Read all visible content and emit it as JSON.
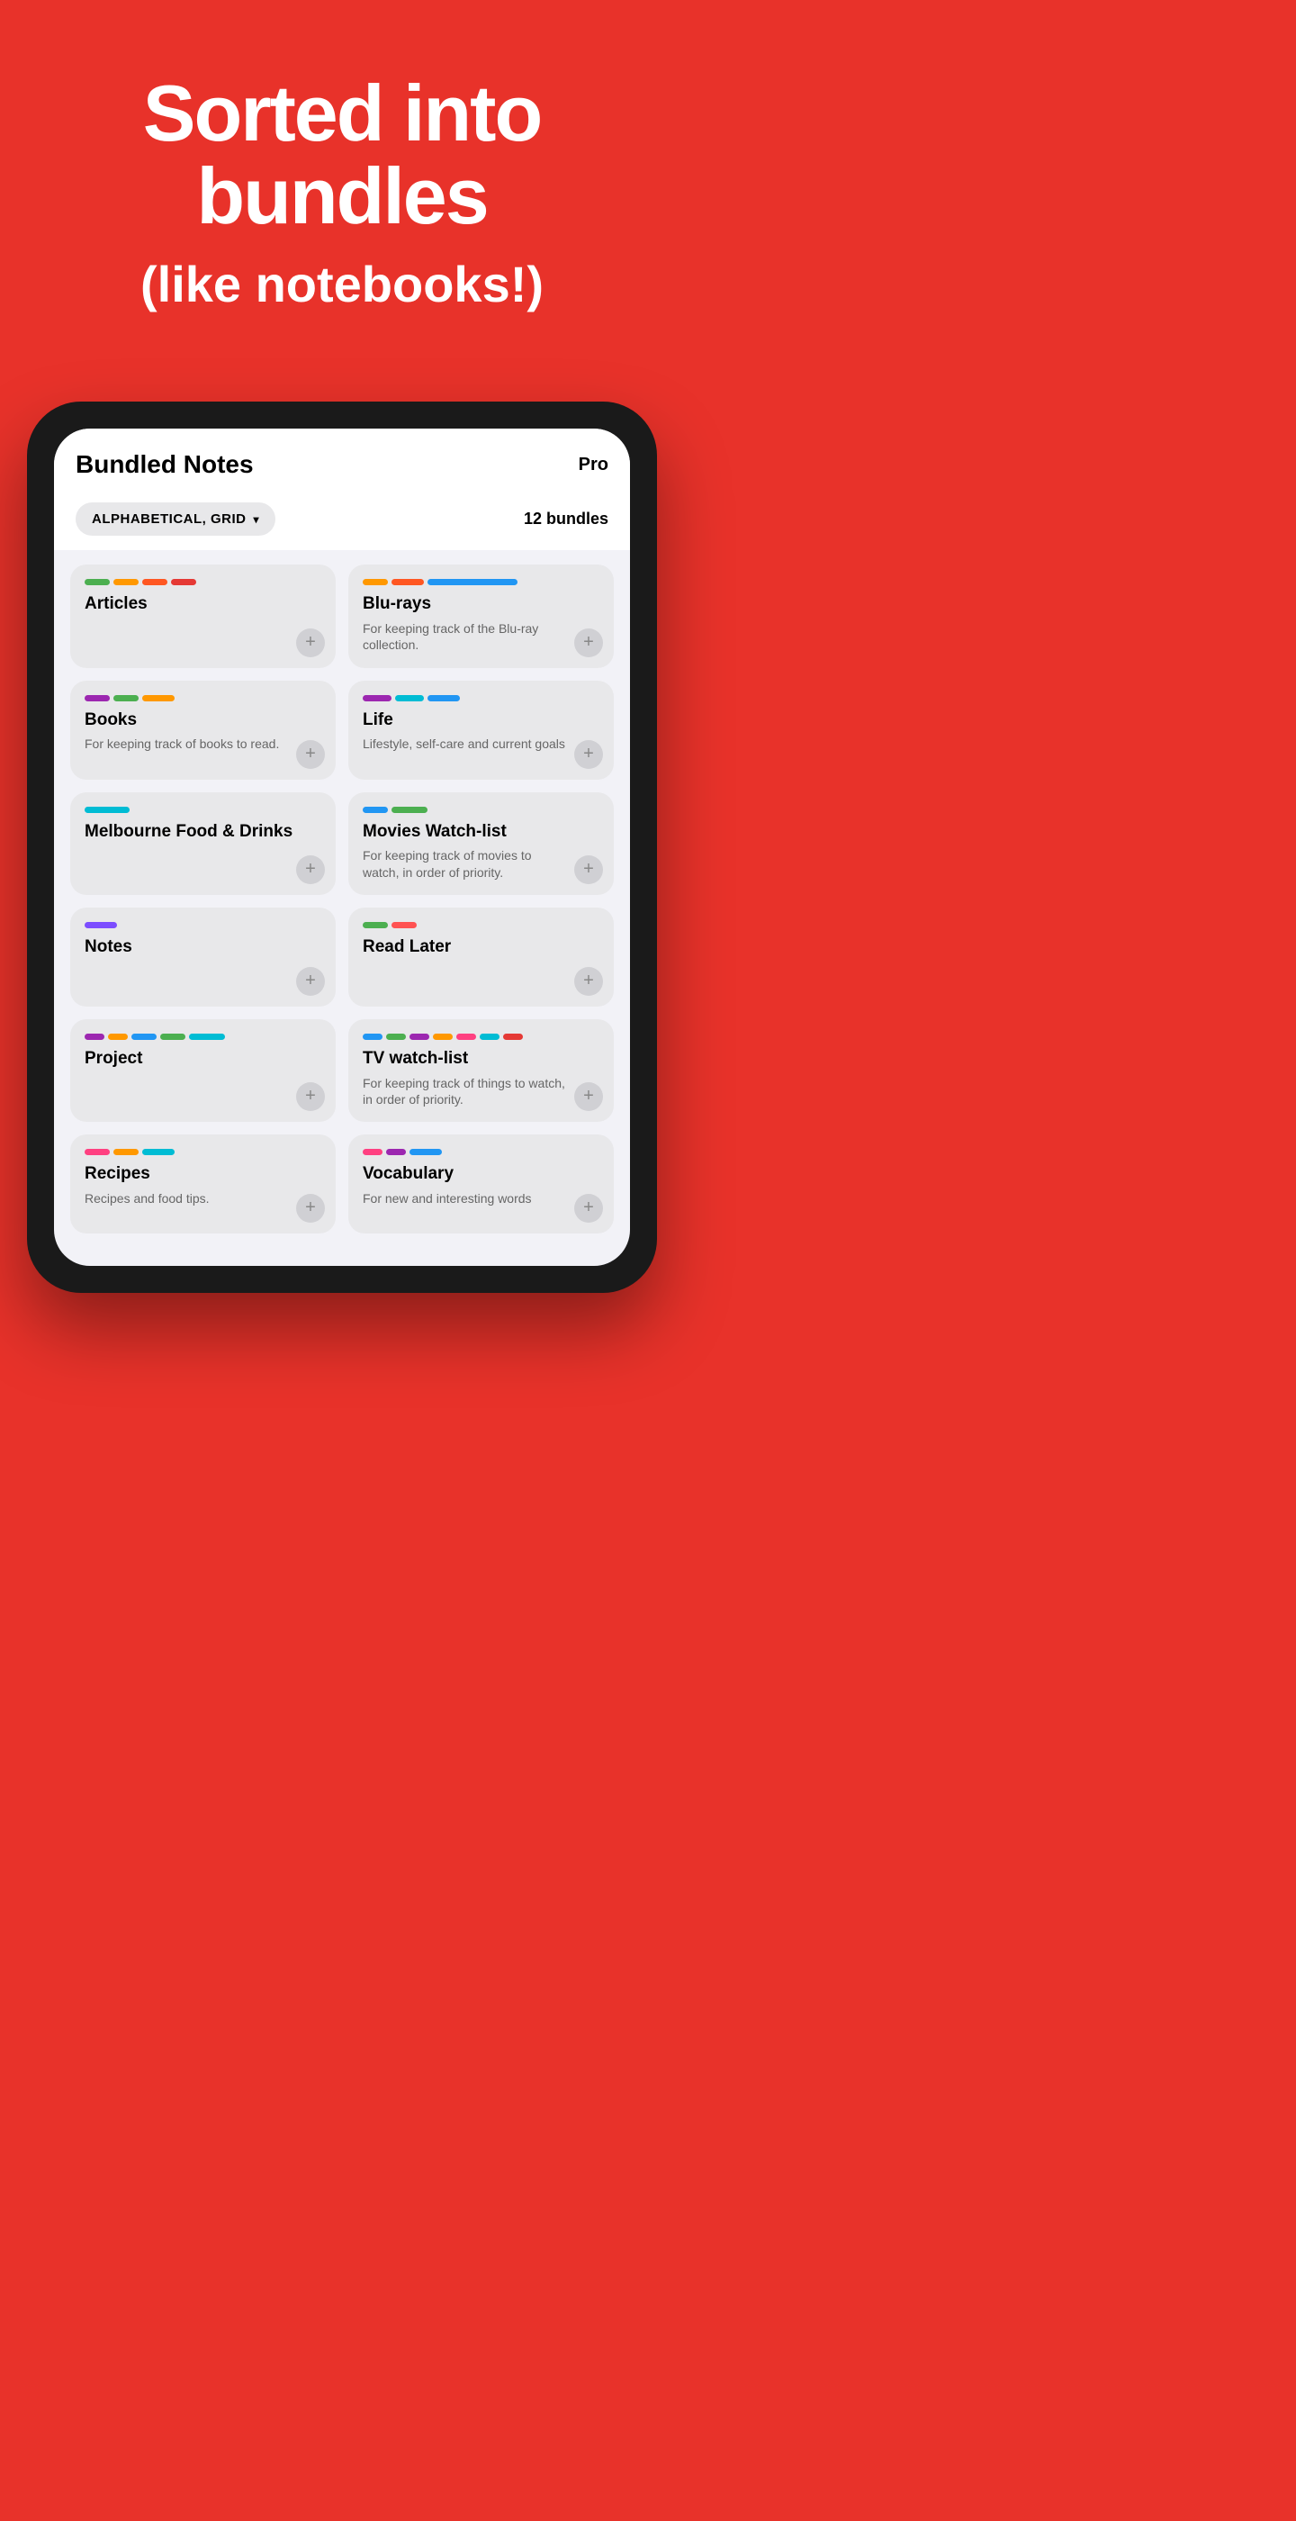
{
  "hero": {
    "title": "Sorted into bundles",
    "subtitle": "(like notebooks!)"
  },
  "app": {
    "title": "Bundled Notes",
    "pro_label": "Pro",
    "sort_label": "ALPHABETICAL, GRID",
    "bundles_count": "12 bundles"
  },
  "bundles": [
    {
      "id": "articles",
      "name": "Articles",
      "desc": ""
    },
    {
      "id": "blurays",
      "name": "Blu-rays",
      "desc": "For keeping track of the Blu-ray collection."
    },
    {
      "id": "books",
      "name": "Books",
      "desc": "For keeping track of books to read."
    },
    {
      "id": "life",
      "name": "Life",
      "desc": "Lifestyle, self-care and current goals"
    },
    {
      "id": "melbourne",
      "name": "Melbourne Food & Drinks",
      "desc": ""
    },
    {
      "id": "movies",
      "name": "Movies Watch-list",
      "desc": "For keeping track of movies to watch, in order of priority."
    },
    {
      "id": "notes",
      "name": "Notes",
      "desc": ""
    },
    {
      "id": "readlater",
      "name": "Read Later",
      "desc": ""
    },
    {
      "id": "project",
      "name": "Project",
      "desc": ""
    },
    {
      "id": "tvwatchlist",
      "name": "TV watch-list",
      "desc": "For keeping track of things to watch, in order of priority."
    },
    {
      "id": "recipes",
      "name": "Recipes",
      "desc": "Recipes and food tips."
    },
    {
      "id": "vocabulary",
      "name": "Vocabulary",
      "desc": "For new and interesting words"
    }
  ],
  "icons": {
    "chevron": "▾",
    "add": "+"
  }
}
